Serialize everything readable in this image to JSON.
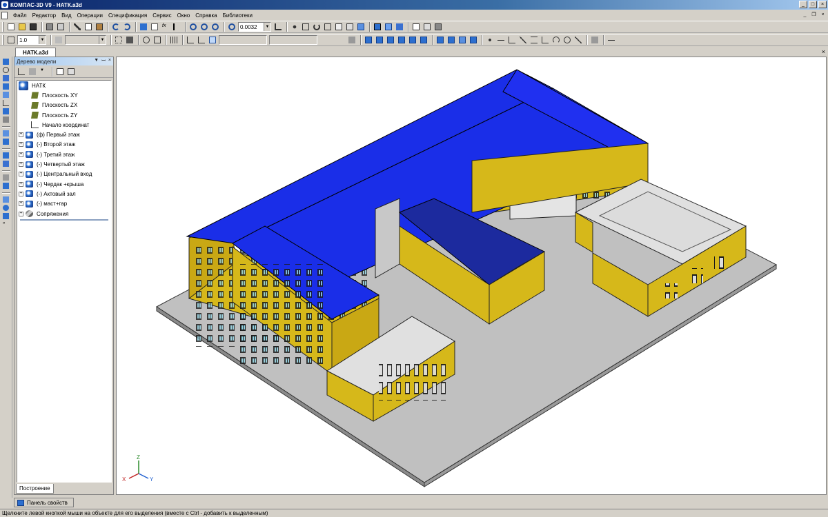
{
  "window": {
    "title": "КОМПАС-3D V9 - НАТК.a3d"
  },
  "menu": [
    "Файл",
    "Редактор",
    "Вид",
    "Операции",
    "Спецификация",
    "Сервис",
    "Окно",
    "Справка",
    "Библиотеки"
  ],
  "toolbar": {
    "zoom_value": "0.0032",
    "line_step_value": "1.0"
  },
  "document_tab": "НАТК.a3d",
  "model_tree": {
    "header": "Дерево модели",
    "root": "НАТК",
    "nodes": [
      {
        "label": "Плоскость XY",
        "icon": "plane-icon",
        "expandable": false
      },
      {
        "label": "Плоскость ZX",
        "icon": "plane-icon",
        "expandable": false
      },
      {
        "label": "Плоскость ZY",
        "icon": "plane-icon",
        "expandable": false
      },
      {
        "label": "Начало координат",
        "icon": "origin-icon",
        "expandable": false
      },
      {
        "label": "(ф) Первый этаж",
        "icon": "part-icon",
        "expandable": true
      },
      {
        "label": "(-) Второй этаж",
        "icon": "part-icon",
        "expandable": true
      },
      {
        "label": "(-) Третий этаж",
        "icon": "part-icon",
        "expandable": true
      },
      {
        "label": "(-) Четвертый этаж",
        "icon": "part-icon",
        "expandable": true
      },
      {
        "label": "(-) Центральный вход",
        "icon": "part-icon",
        "expandable": true
      },
      {
        "label": "(-) Чердак +крыша",
        "icon": "part-icon",
        "expandable": true
      },
      {
        "label": "(-) Актовый зал",
        "icon": "part-icon",
        "expandable": true
      },
      {
        "label": "(-) маст+гар",
        "icon": "part-icon",
        "expandable": true
      },
      {
        "label": "Сопряжения",
        "icon": "mate-icon",
        "expandable": true
      }
    ],
    "bottom_tab": "Построение"
  },
  "axis_labels": {
    "x": "X",
    "y": "Y",
    "z": "Z"
  },
  "property_panel_tab": "Панель свойств",
  "status_text": "Щелкните левой кнопкой мыши на объекте для его выделения (вместе с Ctrl - добавить к выделенным)",
  "colors": {
    "roof": "#1a2ee8",
    "wall": "#d6b81a",
    "ground": "#c0c0c0",
    "flat_roof": "#e0e0e0"
  }
}
